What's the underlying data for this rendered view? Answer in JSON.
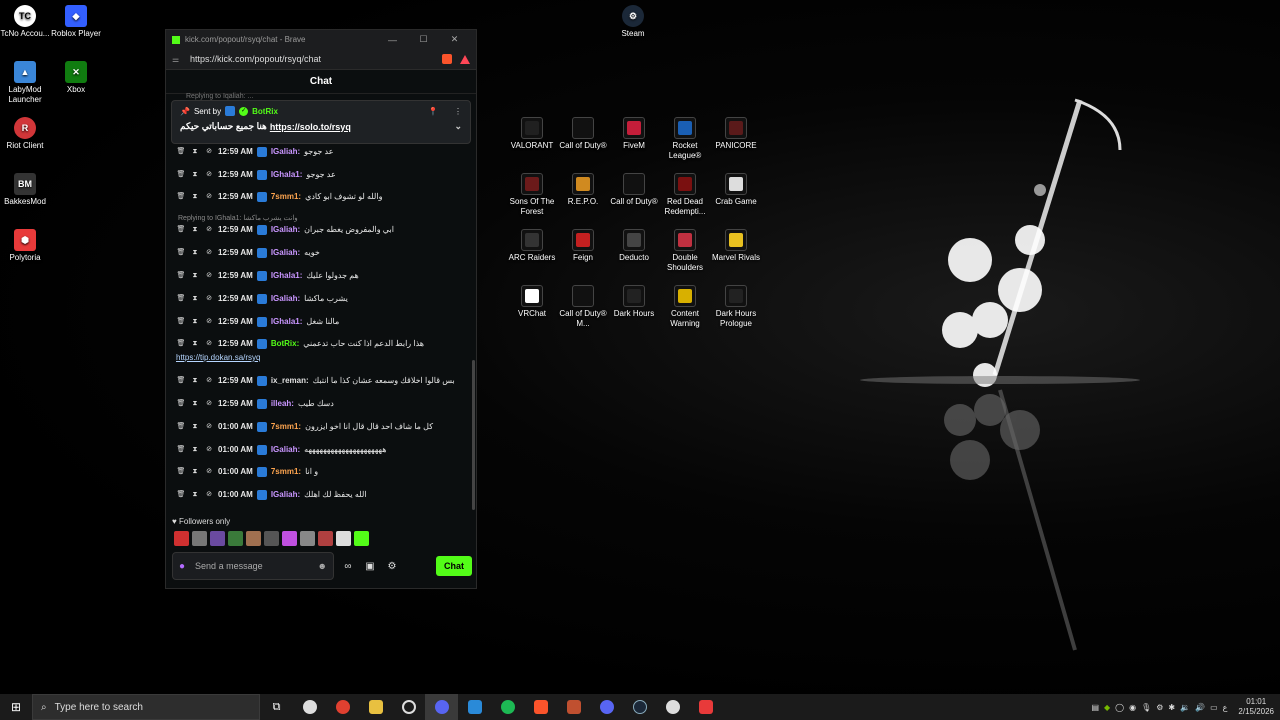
{
  "desktop": {
    "left_icons": [
      {
        "label": "TcNo Accou...",
        "color": "#fff"
      },
      {
        "label": "Roblox Player",
        "color": "#335fff"
      },
      {
        "label": "LabyMod Launcher",
        "color": "#3a86d8"
      },
      {
        "label": "Xbox",
        "color": "#107c10"
      },
      {
        "label": "Riot Client",
        "color": "#d13639"
      },
      {
        "label": "BakkesMod",
        "color": "#222"
      },
      {
        "label": "Polytoria",
        "color": "#e83a3a"
      }
    ],
    "steam_label": "Steam",
    "grid_icons": [
      {
        "label": "VALORANT",
        "color": "#202020"
      },
      {
        "label": "Call of Duty®",
        "color": "#111"
      },
      {
        "label": "FiveM",
        "color": "#c41e3a"
      },
      {
        "label": "Rocket League®",
        "color": "#1a5fb4"
      },
      {
        "label": "PANICORE",
        "color": "#5a1a1a"
      },
      {
        "label": "Sons Of The Forest",
        "color": "#6b1a1a"
      },
      {
        "label": "R.E.P.O.",
        "color": "#d08a20"
      },
      {
        "label": "Call of Duty®",
        "color": "#111"
      },
      {
        "label": "Red Dead Redempti...",
        "color": "#7a1010"
      },
      {
        "label": "Crab Game",
        "color": "#ddd"
      },
      {
        "label": "ARC Raiders",
        "color": "#333"
      },
      {
        "label": "Feign",
        "color": "#c42020"
      },
      {
        "label": "Deducto",
        "color": "#444"
      },
      {
        "label": "Double Shoulders",
        "color": "#c03040"
      },
      {
        "label": "Marvel Rivals",
        "color": "#e8c020"
      },
      {
        "label": "VRChat",
        "color": "#fff"
      },
      {
        "label": "Call of Duty® M...",
        "color": "#111"
      },
      {
        "label": "Dark Hours",
        "color": "#222"
      },
      {
        "label": "Content Warning",
        "color": "#d8b000"
      },
      {
        "label": "Dark Hours Prologue",
        "color": "#222"
      }
    ]
  },
  "browser": {
    "tab_title": "kick.com/popout/rsyq/chat - Brave",
    "url": "https://kick.com/popout/rsyq/chat",
    "minimize": "—",
    "maximize": "☐",
    "close": "✕"
  },
  "chat": {
    "header": "Chat",
    "top_reply": "Replying to Iqaliah: ... ",
    "pinned": {
      "sent_by": "Sent by",
      "user": "BotRix",
      "text": "هنا جميع حساباتي حيكم",
      "link": "https://solo.to/rsyq"
    },
    "messages": [
      {
        "time": "12:59 AM",
        "user": "IGaliah:",
        "color": "#c996ff",
        "text": "عد جوجو"
      },
      {
        "time": "12:59 AM",
        "user": "IGhala1:",
        "color": "#c996ff",
        "text": "عد جوجو"
      },
      {
        "time": "12:59 AM",
        "user": "7smm1:",
        "color": "#ffa54f",
        "text": "والله لو تشوف ابو كادي"
      },
      {
        "time": "12:59 AM",
        "user": "IGaliah:",
        "color": "#c996ff",
        "text": "ابي والمفروض يغطه جبران"
      },
      {
        "time": "12:59 AM",
        "user": "IGaliah:",
        "color": "#c996ff",
        "text": "خويه"
      },
      {
        "time": "12:59 AM",
        "user": "IGhala1:",
        "color": "#c996ff",
        "text": "هم جدولوا عليك"
      },
      {
        "time": "12:59 AM",
        "user": "IGaliah:",
        "color": "#c996ff",
        "text": "يشرب ماكشا"
      },
      {
        "time": "12:59 AM",
        "user": "IGhala1:",
        "color": "#c996ff",
        "text": "مالنا شغل"
      },
      {
        "time": "12:59 AM",
        "user": "BotRix:",
        "color": "#53fc18",
        "text": "هذا رابط الدعم اذا كنت حاب تدعمني"
      },
      {
        "time": "12:59 AM",
        "user": "ix_reman:",
        "color": "#e0e0e0",
        "text": "بس قالوا اخلاقك وسمعه عشان كذا ما انتبك"
      },
      {
        "time": "12:59 AM",
        "user": "illeah:",
        "color": "#c996ff",
        "text": "دسك طيب"
      },
      {
        "time": "01:00 AM",
        "user": "7smm1:",
        "color": "#ffa54f",
        "text": "كل ما شاف احد قال قال انا اخو ايزرون"
      },
      {
        "time": "01:00 AM",
        "user": "IGaliah:",
        "color": "#c996ff",
        "text": "هههههههههههههههههههههه"
      },
      {
        "time": "01:00 AM",
        "user": "7smm1:",
        "color": "#ffa54f",
        "text": "و انا"
      },
      {
        "time": "01:00 AM",
        "user": "IGaliah:",
        "color": "#c996ff",
        "text": "الله يحفظ لك اهلك"
      }
    ],
    "reply_line": "Replying to IGhala1: وانت يشرب ماكشا",
    "botrix_link": "https://tip.dokan.sa/rsyq",
    "followers_only": "Followers only",
    "input_placeholder": "Send a message",
    "chat_button": "Chat"
  },
  "taskbar": {
    "search_placeholder": "Type here to search",
    "time": "01:01",
    "date": "2/15/2026",
    "lang": "ع"
  }
}
